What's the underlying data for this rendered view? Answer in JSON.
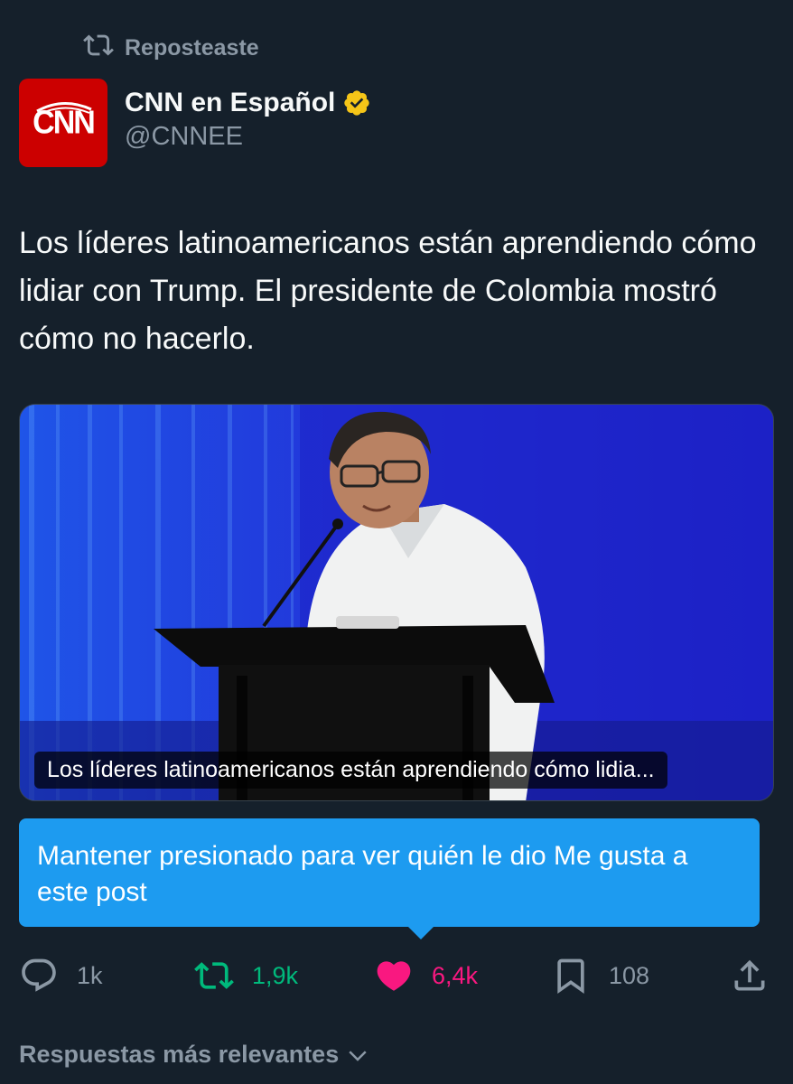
{
  "repost": {
    "label": "Reposteaste",
    "icon": "repost-icon"
  },
  "author": {
    "name": "CNN en Español",
    "handle": "@CNNEE",
    "avatar_text": "CNN",
    "verified_icon": "verified-badge-icon",
    "verified_color": "#f5c518"
  },
  "post": {
    "text": "Los líderes latinoamericanos están aprendiendo cómo lidiar con Trump. El presidente de Colombia mostró cómo no hacerlo."
  },
  "media": {
    "caption": "Los líderes latinoamericanos están aprendiendo cómo lidia..."
  },
  "tooltip": {
    "text": "Mantener presionado para ver quién le dio Me gusta a este post"
  },
  "actions": {
    "reply": {
      "icon": "reply-icon",
      "count": "1k"
    },
    "retweet": {
      "icon": "retweet-icon",
      "count": "1,9k",
      "color": "#00ba7c"
    },
    "like": {
      "icon": "heart-filled-icon",
      "count": "6,4k",
      "color": "#f91880"
    },
    "bookmark": {
      "icon": "bookmark-icon",
      "count": "108"
    },
    "share": {
      "icon": "share-icon"
    }
  },
  "replies_sort": {
    "label": "Respuestas más relevantes",
    "icon": "chevron-down-icon"
  },
  "colors": {
    "background": "#15202b",
    "text_primary": "#f7f9f9",
    "text_secondary": "#8b98a5",
    "accent": "#1d9bf0",
    "cnn_red": "#cc0000"
  }
}
